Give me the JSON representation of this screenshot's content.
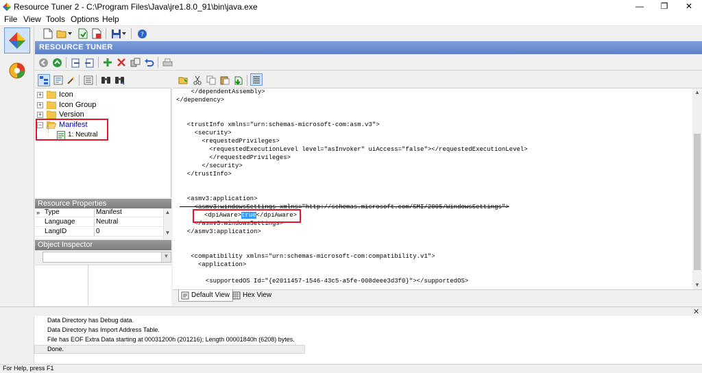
{
  "window": {
    "title": "Resource Tuner 2 - C:\\Program Files\\Java\\jre1.8.0_91\\bin\\java.exe",
    "min_glyph": "—",
    "max_glyph": "❐",
    "close_glyph": "✕"
  },
  "menu": [
    "File",
    "View",
    "Tools",
    "Options",
    "Help"
  ],
  "header": {
    "label": "RESOURCE TUNER"
  },
  "tree": {
    "items": [
      {
        "label": "Icon",
        "expander": "+"
      },
      {
        "label": "Icon Group",
        "expander": "+"
      },
      {
        "label": "Version",
        "expander": "+"
      },
      {
        "label": "Manifest",
        "expander": "−"
      }
    ],
    "child": {
      "label": "1: Neutral"
    }
  },
  "resource_properties": {
    "title": "Resource Properties",
    "gutter_arrow": "»",
    "rows": [
      {
        "key": "Type",
        "value": "Manifest"
      },
      {
        "key": "Language",
        "value": "Neutral"
      },
      {
        "key": "LangID",
        "value": "0"
      }
    ]
  },
  "object_inspector": {
    "title": "Object Inspector"
  },
  "editor": {
    "lines": [
      "    </dependentAssembly>",
      "</dependency>",
      "",
      "",
      "  <trustInfo xmlns=\"urn:schemas-microsoft-com:asm.v3\">",
      "    <security>",
      "      <requestedPrivileges>",
      "        <requestedExecutionLevel level=\"asInvoker\" uiAccess=\"false\"></requestedExecutionLevel>",
      "        </requestedPrivileges>",
      "      </security>",
      "  </trustInfo>",
      "",
      "  <asmv3:application>",
      "    <asmv3:windowsSettings xmlns=\"http://schemas.microsoft.com/SMI/2005/WindowsSettings\">",
      "",
      "    </asmv3:windowsSettings>",
      "  </asmv3:application>",
      "",
      "",
      "   <compatibility xmlns=\"urn:schemas-microsoft-com:compatibility.v1\">",
      "     <application>",
      "",
      "       <supportedOS Id=\"{e2011457-1546-43c5-a5fe-008deee3d3f0}\"></supportedOS>"
    ],
    "dpi_line": {
      "open_tag": "<dpiAware>",
      "value": "true",
      "close_tag": "</dpiAware>"
    }
  },
  "view_tabs": {
    "default_view": "Default View",
    "hex_view": "Hex View"
  },
  "log": {
    "close_glyph": "✕",
    "lines": [
      "Data Directory has Debug data.",
      "Data Directory has Import Address Table.",
      "File has EOF Extra Data starting at 00031200h (201216); Length 00001840h (6208) bytes.",
      "Done."
    ]
  },
  "status": {
    "text": "For Help, press F1"
  }
}
